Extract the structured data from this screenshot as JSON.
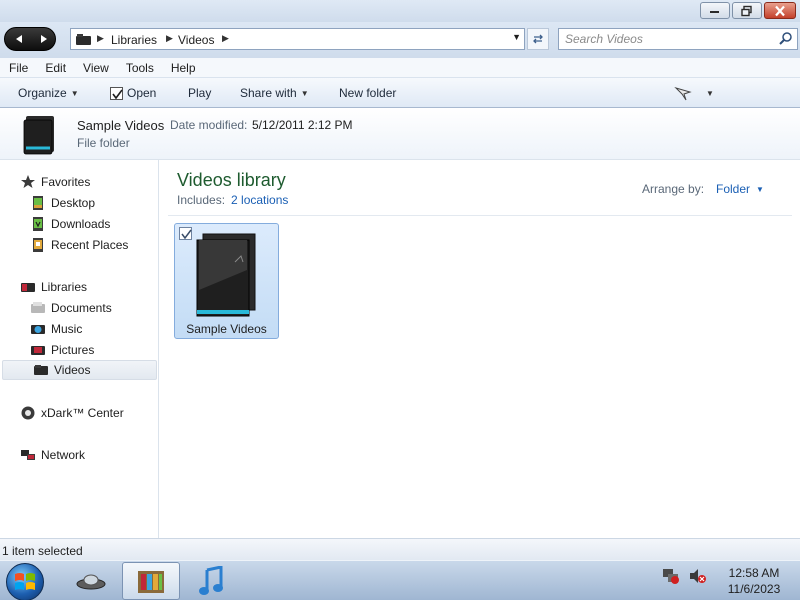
{
  "address": {
    "crumbs": [
      "Libraries",
      "Videos"
    ]
  },
  "search": {
    "placeholder": "Search Videos"
  },
  "menu": {
    "items": [
      "File",
      "Edit",
      "View",
      "Tools",
      "Help"
    ]
  },
  "commands": {
    "organize": "Organize",
    "open": "Open",
    "play": "Play",
    "share_with": "Share with",
    "new_folder": "New folder"
  },
  "details": {
    "name": "Sample Videos",
    "date_label": "Date modified:",
    "date_value": "5/12/2011 2:12 PM",
    "type": "File folder"
  },
  "nav": {
    "favorites": "Favorites",
    "desktop": "Desktop",
    "downloads": "Downloads",
    "recent_places": "Recent Places",
    "libraries": "Libraries",
    "documents": "Documents",
    "music": "Music",
    "pictures": "Pictures",
    "videos": "Videos",
    "xdark": "xDark™ Center",
    "network": "Network"
  },
  "library": {
    "title": "Videos library",
    "includes_label": "Includes:",
    "includes_link": "2 locations",
    "arrange_label": "Arrange by:",
    "arrange_value": "Folder"
  },
  "items": [
    {
      "name": "Sample Videos",
      "selected": true,
      "checked": true
    }
  ],
  "status": {
    "text": "1 item selected"
  },
  "taskbar": {
    "time": "12:58 AM",
    "date": "11/6/2023"
  },
  "colors": {
    "library_title": "#1e5b2f",
    "link": "#1a5fb4",
    "selection": "#c3dcf5"
  }
}
